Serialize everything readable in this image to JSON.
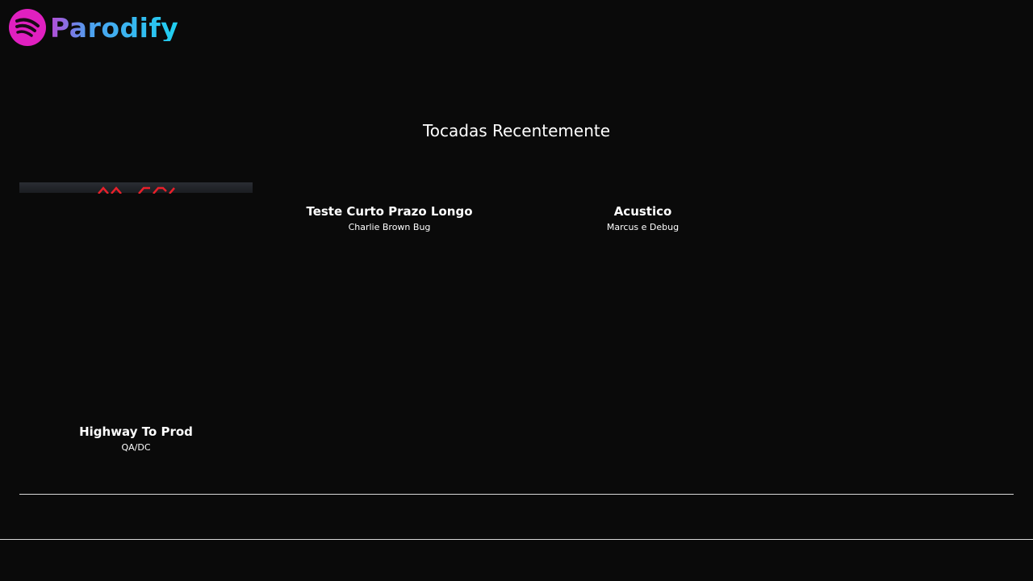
{
  "app": {
    "name": "Parodify",
    "logo_icon": "spotify-like-icon",
    "colors": {
      "background": "#0a0a0a",
      "logo_circle": "#e020c0",
      "logo_text_start": "#b64bd6",
      "logo_text_end": "#1fd0f0",
      "divider": "#d9d9d9"
    }
  },
  "recent": {
    "title": "Tocadas Recentemente",
    "items": [
      {
        "title": "Highway To Prod",
        "artist": "QA/DC"
      },
      {
        "title": "Teste Curto Prazo Longo",
        "artist": "Charlie Brown Bug"
      },
      {
        "title": "Acustico",
        "artist": "Marcus e Debug"
      }
    ]
  }
}
